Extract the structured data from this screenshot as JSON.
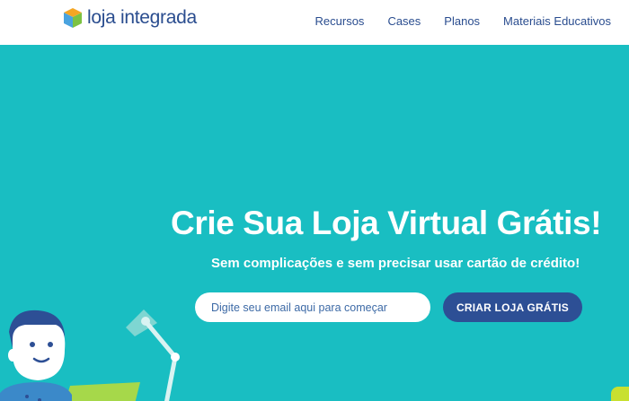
{
  "brand": {
    "name": "loja integrada",
    "colors": {
      "primary": "#2a4d8f",
      "hero_bg": "#19bec2",
      "cta": "#2d4f95",
      "accent_green": "#c8e030"
    }
  },
  "nav": {
    "items": [
      {
        "label": "Recursos"
      },
      {
        "label": "Cases"
      },
      {
        "label": "Planos"
      },
      {
        "label": "Materiais Educativos"
      }
    ]
  },
  "hero": {
    "title": "Crie Sua Loja Virtual Grátis!",
    "subtitle": "Sem complicações e sem precisar usar cartão de crédito!",
    "email_placeholder": "Digite seu email aqui para começar",
    "email_value": "",
    "cta_label": "CRIAR LOJA GRÁTIS"
  },
  "icons": {
    "logo": "cube-logo-icon",
    "illustration": "person-with-desk-lamp-illustration"
  }
}
